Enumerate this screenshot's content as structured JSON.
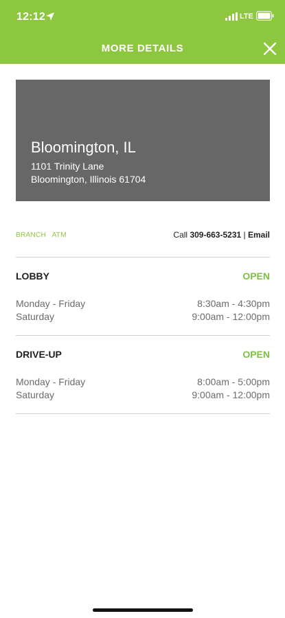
{
  "status_bar": {
    "time": "12:12",
    "network": "LTE"
  },
  "header": {
    "title": "MORE DETAILS"
  },
  "branch_card": {
    "city": "Bloomington, IL",
    "address_line1": "1101 Trinity Lane",
    "address_line2": "Bloomington, Illinois 61704"
  },
  "tags": [
    "BRANCH",
    "ATM"
  ],
  "contact": {
    "call_label": "Call",
    "phone": "309-663-5231",
    "separator": "|",
    "email_label": "Email"
  },
  "sections": [
    {
      "title": "LOBBY",
      "status": "OPEN",
      "rows": [
        {
          "day": "Monday - Friday",
          "hours": "8:30am - 4:30pm"
        },
        {
          "day": "Saturday",
          "hours": "9:00am - 12:00pm"
        }
      ]
    },
    {
      "title": "DRIVE-UP",
      "status": "OPEN",
      "rows": [
        {
          "day": "Monday - Friday",
          "hours": "8:00am - 5:00pm"
        },
        {
          "day": "Saturday",
          "hours": "9:00am - 12:00pm"
        }
      ]
    }
  ],
  "colors": {
    "accent": "#8dc63f",
    "open_status": "#7cc143",
    "card_bg": "#676767"
  },
  "icons": {
    "location": "location-arrow-icon",
    "signal": "cellular-signal-icon",
    "battery": "battery-icon",
    "close": "close-icon"
  }
}
